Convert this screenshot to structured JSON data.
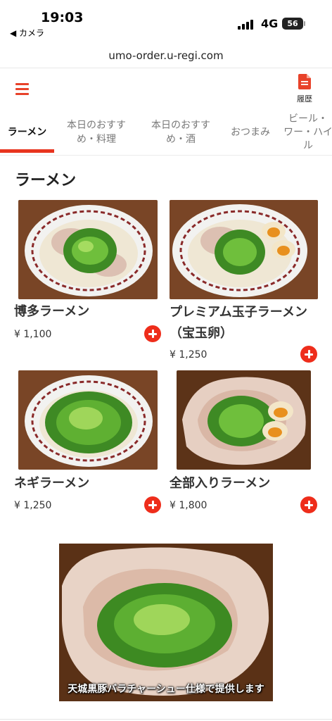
{
  "status_bar": {
    "time": "19:03",
    "back_label": "◀ カメラ",
    "network": "4G",
    "battery": "56"
  },
  "browser": {
    "url": "umo-order.u-regi.com"
  },
  "header": {
    "menu_icon": "hamburger-menu-icon",
    "history_icon": "document-icon",
    "history_label": "履歴",
    "accent_color": "#e8422a"
  },
  "tabs": [
    {
      "label": "ラーメン",
      "active": true
    },
    {
      "label": "本日のおすす\nめ・料理",
      "active": false
    },
    {
      "label": "本日のおすす\nめ・酒",
      "active": false
    },
    {
      "label": "おつまみ",
      "active": false
    },
    {
      "label": "ビール・\nワー・ハイ\nル",
      "active": false
    }
  ],
  "section": {
    "title": "ラーメン"
  },
  "items": [
    {
      "name": "博多ラーメン",
      "price": "¥ 1,100"
    },
    {
      "name": "プレミアム玉子ラーメン\n（宝玉卵）",
      "price": "¥ 1,250"
    },
    {
      "name": "ネギラーメン",
      "price": "¥ 1,250"
    },
    {
      "name": "全部入りラーメン",
      "price": "¥ 1,800"
    }
  ],
  "banner": {
    "caption": "天城黒豚バラチャーシュー仕様で提供します"
  },
  "colors": {
    "accent": "#e8341f",
    "add_button": "#ee2d1b",
    "text": "#333333"
  }
}
